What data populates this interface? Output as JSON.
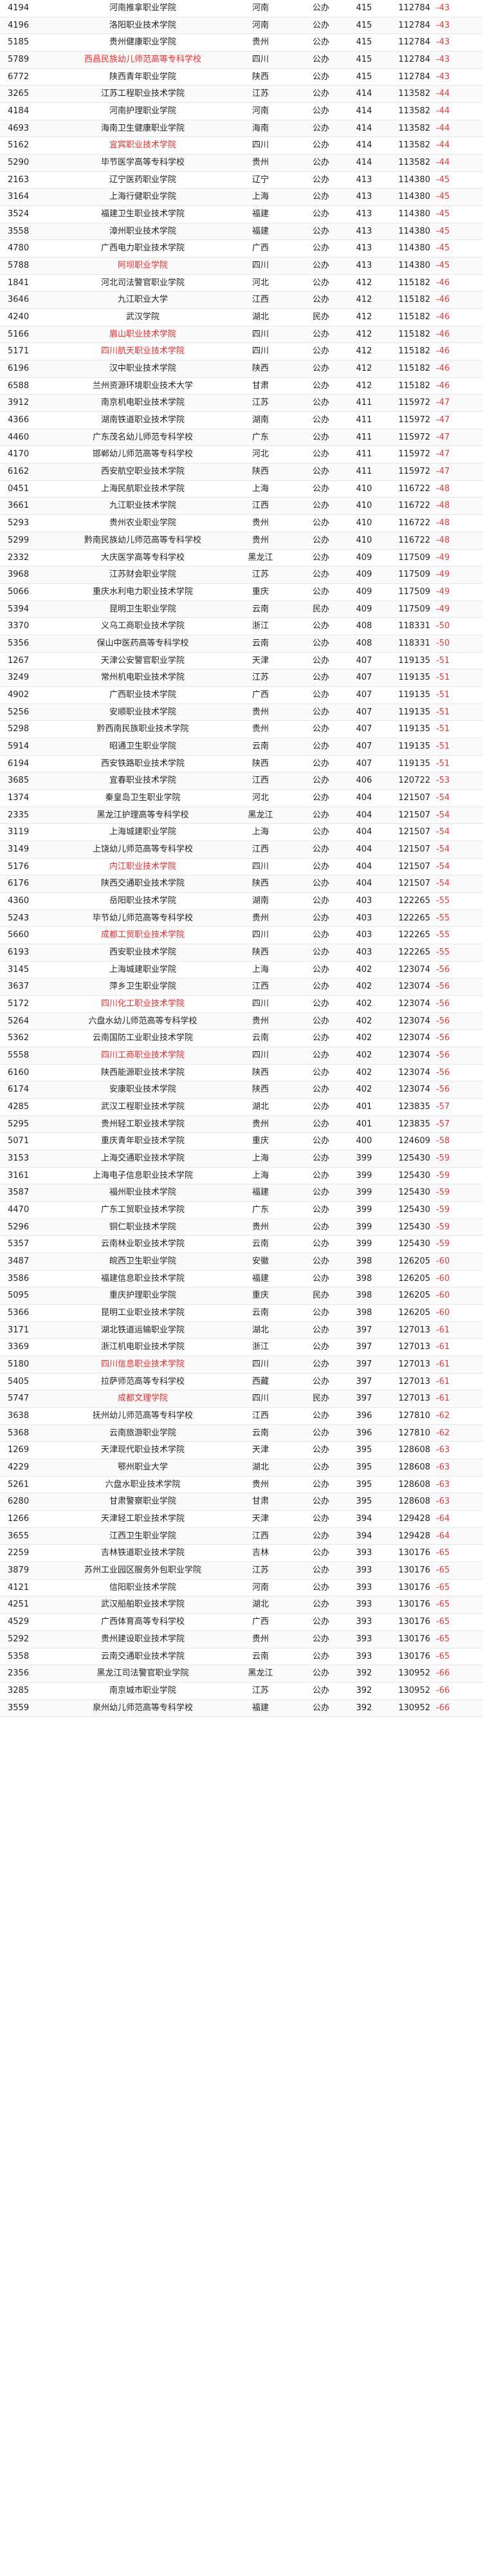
{
  "rows": [
    {
      "code": "4194",
      "name": "河南推拿职业学院",
      "prov": "河南",
      "type": "公办",
      "score": "415",
      "rank": "112784",
      "diff": "-43",
      "red": false
    },
    {
      "code": "4196",
      "name": "洛阳职业技术学院",
      "prov": "河南",
      "type": "公办",
      "score": "415",
      "rank": "112784",
      "diff": "-43",
      "red": false
    },
    {
      "code": "5185",
      "name": "贵州健康职业学院",
      "prov": "贵州",
      "type": "公办",
      "score": "415",
      "rank": "112784",
      "diff": "-43",
      "red": false
    },
    {
      "code": "5789",
      "name": "西昌民族幼儿师范高等专科学校",
      "prov": "四川",
      "type": "公办",
      "score": "415",
      "rank": "112784",
      "diff": "-43",
      "red": true
    },
    {
      "code": "6772",
      "name": "陕西青年职业学院",
      "prov": "陕西",
      "type": "公办",
      "score": "415",
      "rank": "112784",
      "diff": "-43",
      "red": false
    },
    {
      "code": "3265",
      "name": "江苏工程职业技术学院",
      "prov": "江苏",
      "type": "公办",
      "score": "414",
      "rank": "113582",
      "diff": "-44",
      "red": false
    },
    {
      "code": "4184",
      "name": "河南护理职业学院",
      "prov": "河南",
      "type": "公办",
      "score": "414",
      "rank": "113582",
      "diff": "-44",
      "red": false
    },
    {
      "code": "4693",
      "name": "海南卫生健康职业学院",
      "prov": "海南",
      "type": "公办",
      "score": "414",
      "rank": "113582",
      "diff": "-44",
      "red": false
    },
    {
      "code": "5162",
      "name": "宜宾职业技术学院",
      "prov": "四川",
      "type": "公办",
      "score": "414",
      "rank": "113582",
      "diff": "-44",
      "red": true
    },
    {
      "code": "5290",
      "name": "毕节医学高等专科学校",
      "prov": "贵州",
      "type": "公办",
      "score": "414",
      "rank": "113582",
      "diff": "-44",
      "red": false
    },
    {
      "code": "2163",
      "name": "辽宁医药职业学院",
      "prov": "辽宁",
      "type": "公办",
      "score": "413",
      "rank": "114380",
      "diff": "-45",
      "red": false
    },
    {
      "code": "3164",
      "name": "上海行健职业学院",
      "prov": "上海",
      "type": "公办",
      "score": "413",
      "rank": "114380",
      "diff": "-45",
      "red": false
    },
    {
      "code": "3524",
      "name": "福建卫生职业技术学院",
      "prov": "福建",
      "type": "公办",
      "score": "413",
      "rank": "114380",
      "diff": "-45",
      "red": false
    },
    {
      "code": "3558",
      "name": "漳州职业技术学院",
      "prov": "福建",
      "type": "公办",
      "score": "413",
      "rank": "114380",
      "diff": "-45",
      "red": false
    },
    {
      "code": "4780",
      "name": "广西电力职业技术学院",
      "prov": "广西",
      "type": "公办",
      "score": "413",
      "rank": "114380",
      "diff": "-45",
      "red": false
    },
    {
      "code": "5788",
      "name": "阿坝职业学院",
      "prov": "四川",
      "type": "公办",
      "score": "413",
      "rank": "114380",
      "diff": "-45",
      "red": true
    },
    {
      "code": "1841",
      "name": "河北司法警官职业学院",
      "prov": "河北",
      "type": "公办",
      "score": "412",
      "rank": "115182",
      "diff": "-46",
      "red": false
    },
    {
      "code": "3646",
      "name": "九江职业大学",
      "prov": "江西",
      "type": "公办",
      "score": "412",
      "rank": "115182",
      "diff": "-46",
      "red": false
    },
    {
      "code": "4240",
      "name": "武汉学院",
      "prov": "湖北",
      "type": "民办",
      "score": "412",
      "rank": "115182",
      "diff": "-46",
      "red": false
    },
    {
      "code": "5166",
      "name": "眉山职业技术学院",
      "prov": "四川",
      "type": "公办",
      "score": "412",
      "rank": "115182",
      "diff": "-46",
      "red": true
    },
    {
      "code": "5171",
      "name": "四川航天职业技术学院",
      "prov": "四川",
      "type": "公办",
      "score": "412",
      "rank": "115182",
      "diff": "-46",
      "red": true
    },
    {
      "code": "6196",
      "name": "汉中职业技术学院",
      "prov": "陕西",
      "type": "公办",
      "score": "412",
      "rank": "115182",
      "diff": "-46",
      "red": false
    },
    {
      "code": "6588",
      "name": "兰州资源环境职业技术大学",
      "prov": "甘肃",
      "type": "公办",
      "score": "412",
      "rank": "115182",
      "diff": "-46",
      "red": false
    },
    {
      "code": "3912",
      "name": "南京机电职业技术学院",
      "prov": "江苏",
      "type": "公办",
      "score": "411",
      "rank": "115972",
      "diff": "-47",
      "red": false
    },
    {
      "code": "4366",
      "name": "湖南铁道职业技术学院",
      "prov": "湖南",
      "type": "公办",
      "score": "411",
      "rank": "115972",
      "diff": "-47",
      "red": false
    },
    {
      "code": "4460",
      "name": "广东茂名幼儿师范专科学校",
      "prov": "广东",
      "type": "公办",
      "score": "411",
      "rank": "115972",
      "diff": "-47",
      "red": false
    },
    {
      "code": "4170",
      "name": "邯郸幼儿师范高等专科学校",
      "prov": "河北",
      "type": "公办",
      "score": "411",
      "rank": "115972",
      "diff": "-47",
      "red": false
    },
    {
      "code": "6162",
      "name": "西安航空职业技术学院",
      "prov": "陕西",
      "type": "公办",
      "score": "411",
      "rank": "115972",
      "diff": "-47",
      "red": false
    },
    {
      "code": "0451",
      "name": "上海民航职业技术学院",
      "prov": "上海",
      "type": "公办",
      "score": "410",
      "rank": "116722",
      "diff": "-48",
      "red": false
    },
    {
      "code": "3661",
      "name": "九江职业技术学院",
      "prov": "江西",
      "type": "公办",
      "score": "410",
      "rank": "116722",
      "diff": "-48",
      "red": false
    },
    {
      "code": "5293",
      "name": "贵州农业职业学院",
      "prov": "贵州",
      "type": "公办",
      "score": "410",
      "rank": "116722",
      "diff": "-48",
      "red": false
    },
    {
      "code": "5299",
      "name": "黔南民族幼儿师范高等专科学校",
      "prov": "贵州",
      "type": "公办",
      "score": "410",
      "rank": "116722",
      "diff": "-48",
      "red": false
    },
    {
      "code": "2332",
      "name": "大庆医学高等专科学校",
      "prov": "黑龙江",
      "type": "公办",
      "score": "409",
      "rank": "117509",
      "diff": "-49",
      "red": false
    },
    {
      "code": "3968",
      "name": "江苏财会职业学院",
      "prov": "江苏",
      "type": "公办",
      "score": "409",
      "rank": "117509",
      "diff": "-49",
      "red": false
    },
    {
      "code": "5066",
      "name": "重庆水利电力职业技术学院",
      "prov": "重庆",
      "type": "公办",
      "score": "409",
      "rank": "117509",
      "diff": "-49",
      "red": false
    },
    {
      "code": "5394",
      "name": "昆明卫生职业学院",
      "prov": "云南",
      "type": "民办",
      "score": "409",
      "rank": "117509",
      "diff": "-49",
      "red": false
    },
    {
      "code": "3370",
      "name": "义乌工商职业技术学院",
      "prov": "浙江",
      "type": "公办",
      "score": "408",
      "rank": "118331",
      "diff": "-50",
      "red": false
    },
    {
      "code": "5356",
      "name": "保山中医药高等专科学校",
      "prov": "云南",
      "type": "公办",
      "score": "408",
      "rank": "118331",
      "diff": "-50",
      "red": false
    },
    {
      "code": "1267",
      "name": "天津公安警官职业学院",
      "prov": "天津",
      "type": "公办",
      "score": "407",
      "rank": "119135",
      "diff": "-51",
      "red": false
    },
    {
      "code": "3249",
      "name": "常州机电职业技术学院",
      "prov": "江苏",
      "type": "公办",
      "score": "407",
      "rank": "119135",
      "diff": "-51",
      "red": false
    },
    {
      "code": "4902",
      "name": "广西职业技术学院",
      "prov": "广西",
      "type": "公办",
      "score": "407",
      "rank": "119135",
      "diff": "-51",
      "red": false
    },
    {
      "code": "5256",
      "name": "安顺职业技术学院",
      "prov": "贵州",
      "type": "公办",
      "score": "407",
      "rank": "119135",
      "diff": "-51",
      "red": false
    },
    {
      "code": "5298",
      "name": "黔西南民族职业技术学院",
      "prov": "贵州",
      "type": "公办",
      "score": "407",
      "rank": "119135",
      "diff": "-51",
      "red": false
    },
    {
      "code": "5914",
      "name": "昭通卫生职业学院",
      "prov": "云南",
      "type": "公办",
      "score": "407",
      "rank": "119135",
      "diff": "-51",
      "red": false
    },
    {
      "code": "6194",
      "name": "西安铁路职业技术学院",
      "prov": "陕西",
      "type": "公办",
      "score": "407",
      "rank": "119135",
      "diff": "-51",
      "red": false
    },
    {
      "code": "3685",
      "name": "宜春职业技术学院",
      "prov": "江西",
      "type": "公办",
      "score": "406",
      "rank": "120722",
      "diff": "-53",
      "red": false
    },
    {
      "code": "1374",
      "name": "秦皇岛卫生职业学院",
      "prov": "河北",
      "type": "公办",
      "score": "404",
      "rank": "121507",
      "diff": "-54",
      "red": false
    },
    {
      "code": "2335",
      "name": "黑龙江护理高等专科学校",
      "prov": "黑龙江",
      "type": "公办",
      "score": "404",
      "rank": "121507",
      "diff": "-54",
      "red": false
    },
    {
      "code": "3119",
      "name": "上海城建职业学院",
      "prov": "上海",
      "type": "公办",
      "score": "404",
      "rank": "121507",
      "diff": "-54",
      "red": false
    },
    {
      "code": "3149",
      "name": "上饶幼儿师范高等专科学校",
      "prov": "江西",
      "type": "公办",
      "score": "404",
      "rank": "121507",
      "diff": "-54",
      "red": false
    },
    {
      "code": "5176",
      "name": "内江职业技术学院",
      "prov": "四川",
      "type": "公办",
      "score": "404",
      "rank": "121507",
      "diff": "-54",
      "red": true
    },
    {
      "code": "6176",
      "name": "陕西交通职业技术学院",
      "prov": "陕西",
      "type": "公办",
      "score": "404",
      "rank": "121507",
      "diff": "-54",
      "red": false
    },
    {
      "code": "4360",
      "name": "岳阳职业技术学院",
      "prov": "湖南",
      "type": "公办",
      "score": "403",
      "rank": "122265",
      "diff": "-55",
      "red": false
    },
    {
      "code": "5243",
      "name": "毕节幼儿师范高等专科学校",
      "prov": "贵州",
      "type": "公办",
      "score": "403",
      "rank": "122265",
      "diff": "-55",
      "red": false
    },
    {
      "code": "5660",
      "name": "成都工贸职业技术学院",
      "prov": "四川",
      "type": "公办",
      "score": "403",
      "rank": "122265",
      "diff": "-55",
      "red": true
    },
    {
      "code": "6193",
      "name": "西安职业技术学院",
      "prov": "陕西",
      "type": "公办",
      "score": "403",
      "rank": "122265",
      "diff": "-55",
      "red": false
    },
    {
      "code": "3145",
      "name": "上海城建职业学院",
      "prov": "上海",
      "type": "公办",
      "score": "402",
      "rank": "123074",
      "diff": "-56",
      "red": false
    },
    {
      "code": "3637",
      "name": "萍乡卫生职业学院",
      "prov": "江西",
      "type": "公办",
      "score": "402",
      "rank": "123074",
      "diff": "-56",
      "red": false
    },
    {
      "code": "5172",
      "name": "四川化工职业技术学院",
      "prov": "四川",
      "type": "公办",
      "score": "402",
      "rank": "123074",
      "diff": "-56",
      "red": true
    },
    {
      "code": "5264",
      "name": "六盘水幼儿师范高等专科学校",
      "prov": "贵州",
      "type": "公办",
      "score": "402",
      "rank": "123074",
      "diff": "-56",
      "red": false
    },
    {
      "code": "5362",
      "name": "云南国防工业职业技术学院",
      "prov": "云南",
      "type": "公办",
      "score": "402",
      "rank": "123074",
      "diff": "-56",
      "red": false
    },
    {
      "code": "5558",
      "name": "四川工商职业技术学院",
      "prov": "四川",
      "type": "公办",
      "score": "402",
      "rank": "123074",
      "diff": "-56",
      "red": true
    },
    {
      "code": "6160",
      "name": "陕西能源职业技术学院",
      "prov": "陕西",
      "type": "公办",
      "score": "402",
      "rank": "123074",
      "diff": "-56",
      "red": false
    },
    {
      "code": "6174",
      "name": "安康职业技术学院",
      "prov": "陕西",
      "type": "公办",
      "score": "402",
      "rank": "123074",
      "diff": "-56",
      "red": false
    },
    {
      "code": "4285",
      "name": "武汉工程职业技术学院",
      "prov": "湖北",
      "type": "公办",
      "score": "401",
      "rank": "123835",
      "diff": "-57",
      "red": false
    },
    {
      "code": "5295",
      "name": "贵州轻工职业技术学院",
      "prov": "贵州",
      "type": "公办",
      "score": "401",
      "rank": "123835",
      "diff": "-57",
      "red": false
    },
    {
      "code": "5071",
      "name": "重庆青年职业技术学院",
      "prov": "重庆",
      "type": "公办",
      "score": "400",
      "rank": "124609",
      "diff": "-58",
      "red": false
    },
    {
      "code": "3153",
      "name": "上海交通职业技术学院",
      "prov": "上海",
      "type": "公办",
      "score": "399",
      "rank": "125430",
      "diff": "-59",
      "red": false
    },
    {
      "code": "3161",
      "name": "上海电子信息职业技术学院",
      "prov": "上海",
      "type": "公办",
      "score": "399",
      "rank": "125430",
      "diff": "-59",
      "red": false
    },
    {
      "code": "3587",
      "name": "福州职业技术学院",
      "prov": "福建",
      "type": "公办",
      "score": "399",
      "rank": "125430",
      "diff": "-59",
      "red": false
    },
    {
      "code": "4470",
      "name": "广东工贸职业技术学院",
      "prov": "广东",
      "type": "公办",
      "score": "399",
      "rank": "125430",
      "diff": "-59",
      "red": false
    },
    {
      "code": "5296",
      "name": "铜仁职业技术学院",
      "prov": "贵州",
      "type": "公办",
      "score": "399",
      "rank": "125430",
      "diff": "-59",
      "red": false
    },
    {
      "code": "5357",
      "name": "云南林业职业技术学院",
      "prov": "云南",
      "type": "公办",
      "score": "399",
      "rank": "125430",
      "diff": "-59",
      "red": false
    },
    {
      "code": "3487",
      "name": "皖西卫生职业学院",
      "prov": "安徽",
      "type": "公办",
      "score": "398",
      "rank": "126205",
      "diff": "-60",
      "red": false
    },
    {
      "code": "3586",
      "name": "福建信息职业技术学院",
      "prov": "福建",
      "type": "公办",
      "score": "398",
      "rank": "126205",
      "diff": "-60",
      "red": false
    },
    {
      "code": "5095",
      "name": "重庆护理职业学院",
      "prov": "重庆",
      "type": "民办",
      "score": "398",
      "rank": "126205",
      "diff": "-60",
      "red": false
    },
    {
      "code": "5366",
      "name": "昆明工业职业技术学院",
      "prov": "云南",
      "type": "公办",
      "score": "398",
      "rank": "126205",
      "diff": "-60",
      "red": false
    },
    {
      "code": "3171",
      "name": "湖北铁道运输职业学院",
      "prov": "湖北",
      "type": "公办",
      "score": "397",
      "rank": "127013",
      "diff": "-61",
      "red": false
    },
    {
      "code": "3369",
      "name": "浙江机电职业技术学院",
      "prov": "浙江",
      "type": "公办",
      "score": "397",
      "rank": "127013",
      "diff": "-61",
      "red": false
    },
    {
      "code": "5180",
      "name": "四川信息职业技术学院",
      "prov": "四川",
      "type": "公办",
      "score": "397",
      "rank": "127013",
      "diff": "-61",
      "red": true
    },
    {
      "code": "5405",
      "name": "拉萨师范高等专科学校",
      "prov": "西藏",
      "type": "公办",
      "score": "397",
      "rank": "127013",
      "diff": "-61",
      "red": false
    },
    {
      "code": "5747",
      "name": "成都文理学院",
      "prov": "四川",
      "type": "民办",
      "score": "397",
      "rank": "127013",
      "diff": "-61",
      "red": true
    },
    {
      "code": "3638",
      "name": "抚州幼儿师范高等专科学校",
      "prov": "江西",
      "type": "公办",
      "score": "396",
      "rank": "127810",
      "diff": "-62",
      "red": false
    },
    {
      "code": "5368",
      "name": "云南旅游职业学院",
      "prov": "云南",
      "type": "公办",
      "score": "396",
      "rank": "127810",
      "diff": "-62",
      "red": false
    },
    {
      "code": "1269",
      "name": "天津现代职业技术学院",
      "prov": "天津",
      "type": "公办",
      "score": "395",
      "rank": "128608",
      "diff": "-63",
      "red": false
    },
    {
      "code": "4229",
      "name": "鄂州职业大学",
      "prov": "湖北",
      "type": "公办",
      "score": "395",
      "rank": "128608",
      "diff": "-63",
      "red": false
    },
    {
      "code": "5261",
      "name": "六盘水职业技术学院",
      "prov": "贵州",
      "type": "公办",
      "score": "395",
      "rank": "128608",
      "diff": "-63",
      "red": false
    },
    {
      "code": "6280",
      "name": "甘肃警察职业学院",
      "prov": "甘肃",
      "type": "公办",
      "score": "395",
      "rank": "128608",
      "diff": "-63",
      "red": false
    },
    {
      "code": "1266",
      "name": "天津轻工职业技术学院",
      "prov": "天津",
      "type": "公办",
      "score": "394",
      "rank": "129428",
      "diff": "-64",
      "red": false
    },
    {
      "code": "3655",
      "name": "江西卫生职业学院",
      "prov": "江西",
      "type": "公办",
      "score": "394",
      "rank": "129428",
      "diff": "-64",
      "red": false
    },
    {
      "code": "2259",
      "name": "吉林铁道职业技术学院",
      "prov": "吉林",
      "type": "公办",
      "score": "393",
      "rank": "130176",
      "diff": "-65",
      "red": false
    },
    {
      "code": "3879",
      "name": "苏州工业园区服务外包职业学院",
      "prov": "江苏",
      "type": "公办",
      "score": "393",
      "rank": "130176",
      "diff": "-65",
      "red": false
    },
    {
      "code": "4121",
      "name": "信阳职业技术学院",
      "prov": "河南",
      "type": "公办",
      "score": "393",
      "rank": "130176",
      "diff": "-65",
      "red": false
    },
    {
      "code": "4251",
      "name": "武汉船舶职业技术学院",
      "prov": "湖北",
      "type": "公办",
      "score": "393",
      "rank": "130176",
      "diff": "-65",
      "red": false
    },
    {
      "code": "4529",
      "name": "广西体育高等专科学校",
      "prov": "广西",
      "type": "公办",
      "score": "393",
      "rank": "130176",
      "diff": "-65",
      "red": false
    },
    {
      "code": "5292",
      "name": "贵州建设职业技术学院",
      "prov": "贵州",
      "type": "公办",
      "score": "393",
      "rank": "130176",
      "diff": "-65",
      "red": false
    },
    {
      "code": "5358",
      "name": "云南交通职业技术学院",
      "prov": "云南",
      "type": "公办",
      "score": "393",
      "rank": "130176",
      "diff": "-65",
      "red": false
    },
    {
      "code": "2356",
      "name": "黑龙江司法警官职业学院",
      "prov": "黑龙江",
      "type": "公办",
      "score": "392",
      "rank": "130952",
      "diff": "-66",
      "red": false
    },
    {
      "code": "3285",
      "name": "南京城市职业学院",
      "prov": "江苏",
      "type": "公办",
      "score": "392",
      "rank": "130952",
      "diff": "-66",
      "red": false
    },
    {
      "code": "3559",
      "name": "泉州幼儿师范高等专科学校",
      "prov": "福建",
      "type": "公办",
      "score": "392",
      "rank": "130952",
      "diff": "-66",
      "red": false
    }
  ],
  "colors": {
    "highlight": "#ff2a2a",
    "diff": "#e83a3a"
  }
}
